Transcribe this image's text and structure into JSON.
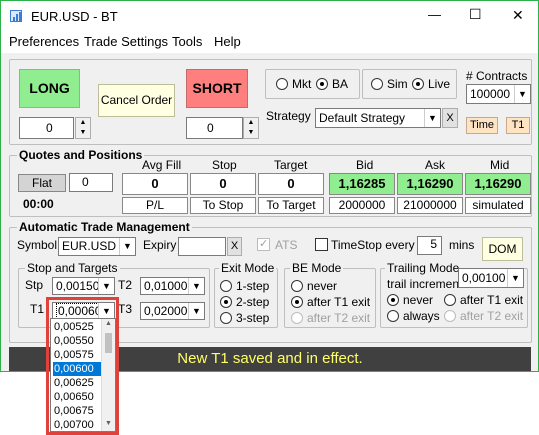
{
  "window": {
    "title": "EUR.USD  - BT",
    "controls": {
      "minimize": "—",
      "maximize": "☐",
      "close": "✕"
    }
  },
  "menu": [
    "Preferences",
    "Trade Settings",
    "Tools",
    "Help"
  ],
  "order_entry": {
    "long_label": "LONG",
    "short_label": "SHORT",
    "cancel_label": "Cancel Order",
    "long_qty": "0",
    "short_qty": "0",
    "long_color": "#90ee90",
    "short_color": "#ff7f7f",
    "mkt_label": "Mkt",
    "ba_label": "BA",
    "sim_label": "Sim",
    "live_label": "Live",
    "contracts_label": "# Contracts",
    "contracts_value": "100000",
    "strategy_label": "Strategy",
    "strategy_value": "Default Strategy",
    "strategy_clear": "X",
    "time_label": "Time",
    "t1_label": "T1"
  },
  "quotes": {
    "title": "Quotes and Positions",
    "position_label": "Flat",
    "position_qty": "0",
    "timer": "00:00",
    "headers": [
      "Avg Fill",
      "Stop",
      "Target",
      "Bid",
      "Ask",
      "Mid"
    ],
    "values": [
      "0",
      "0",
      "0",
      "1,16285",
      "1,16290",
      "1,16290"
    ],
    "sublabels": [
      "P/L",
      "To Stop",
      "To Target",
      "2000000",
      "21000000",
      "simulated"
    ]
  },
  "atm": {
    "title": "Automatic Trade Management",
    "symbol_label": "Symbol",
    "symbol_value": "EUR.USD",
    "expiry_label": "Expiry",
    "expiry_value": "",
    "expiry_clear": "X",
    "ats_label": "ATS",
    "timestop_label": "TimeStop every",
    "timestop_value": "5",
    "mins_label": "mins",
    "dom_label": "DOM"
  },
  "stops": {
    "title": "Stop and Targets",
    "stp_label": "Stp",
    "stp_value": "0,00150",
    "t1_label": "T1",
    "t1_value": "0,00060",
    "t2_label": "T2",
    "t2_value": "0,01000",
    "t3_label": "T3",
    "t3_value": "0,02000"
  },
  "exit_mode": {
    "title": "Exit Mode",
    "options": [
      "1-step",
      "2-step",
      "3-step"
    ]
  },
  "be_mode": {
    "title": "BE Mode",
    "options": [
      "never",
      "after T1 exit",
      "after T2 exit"
    ]
  },
  "trailing": {
    "title": "Trailing Mode",
    "increment_label": "trail increment",
    "increment_value": "0,00100",
    "options": [
      "never",
      "after T1 exit",
      "always",
      "after T2 exit"
    ]
  },
  "status_message": "New T1 saved and in effect.",
  "dropdown_options": [
    "0,00525",
    "0,00550",
    "0,00575",
    "0,00600",
    "0,00625",
    "0,00650",
    "0,00675",
    "0,00700"
  ],
  "dropdown_selected": "0,00600"
}
